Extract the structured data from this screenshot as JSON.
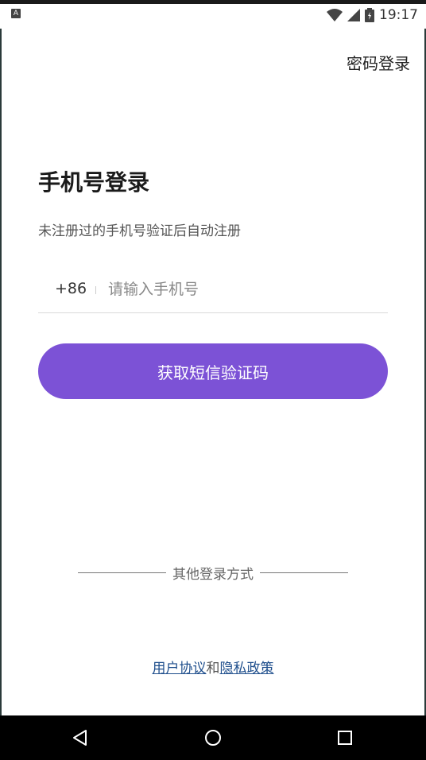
{
  "status_bar": {
    "notification_icon": "A",
    "time": "19:17",
    "icons": [
      "wifi-icon",
      "signal-icon",
      "battery-icon"
    ]
  },
  "header": {
    "password_login_label": "密码登录"
  },
  "main": {
    "title": "手机号登录",
    "subtitle": "未注册过的手机号验证后自动注册",
    "country_code": "+86",
    "phone_placeholder": "请输入手机号",
    "phone_value": "",
    "sms_button_label": "获取短信验证码"
  },
  "other_login": {
    "label": "其他登录方式"
  },
  "agreement": {
    "user_agreement": "用户协议",
    "conjunction": "和",
    "privacy_policy": "隐私政策"
  },
  "navigation": {
    "back": "back-icon",
    "home": "home-icon",
    "recents": "recents-icon"
  },
  "colors": {
    "accent": "#7c52d6",
    "link": "#1e4e8c",
    "nav_background": "#000000"
  }
}
